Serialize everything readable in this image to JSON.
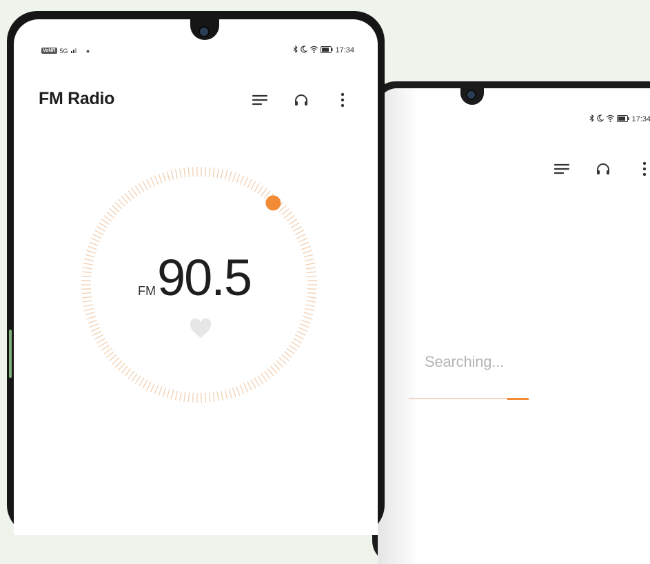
{
  "left_phone": {
    "status_bar": {
      "network_badge": "VoNR",
      "signal_label": "5G",
      "time": "17:34",
      "icons": [
        "bluetooth-icon",
        "moon-icon",
        "wifi-icon",
        "battery-icon"
      ]
    },
    "app_title": "FM Radio",
    "toolbar_icons": [
      "list-icon",
      "headphones-icon",
      "more-vertical-icon"
    ],
    "tuner": {
      "band": "FM",
      "frequency": "90.5",
      "favorite_icon": "heart-icon"
    }
  },
  "right_phone": {
    "status_bar": {
      "time": "17:34",
      "icons": [
        "bluetooth-icon",
        "moon-icon",
        "wifi-icon",
        "battery-icon"
      ]
    },
    "toolbar_icons": [
      "list-icon",
      "headphones-icon",
      "more-vertical-icon"
    ],
    "scan": {
      "status_text": "Searching...",
      "progress_start": 0.82,
      "progress_end": 1.0
    }
  },
  "colors": {
    "background": "#eef4ec",
    "accent": "#f28b36",
    "tick": "#f2cfb1"
  }
}
